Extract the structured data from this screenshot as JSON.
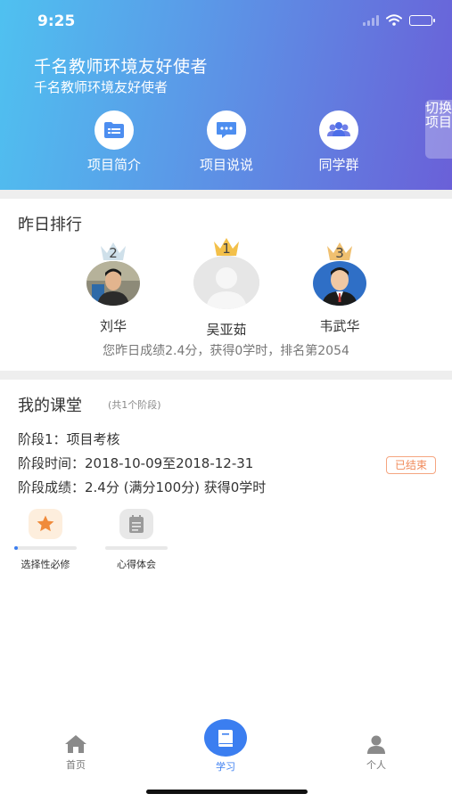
{
  "status_bar": {
    "time": "9:25"
  },
  "header": {
    "title": "千名教师环境友好使者",
    "subtitle": "千名教师环境友好使者",
    "switch_label": "切换项目",
    "actions": [
      {
        "label": "项目简介",
        "icon": "intro-icon"
      },
      {
        "label": "项目说说",
        "icon": "chat-icon"
      },
      {
        "label": "同学群",
        "icon": "group-icon"
      }
    ]
  },
  "ranking": {
    "title": "昨日排行",
    "entries": [
      {
        "rank": "2",
        "name": "刘华"
      },
      {
        "rank": "1",
        "name": "吴亚茹"
      },
      {
        "rank": "3",
        "name": "韦武华"
      }
    ],
    "summary": "您昨日成绩2.4分，获得0学时，排名第2054"
  },
  "course": {
    "title": "我的课堂",
    "count": "(共1个阶段)",
    "stage": "阶段1：项目考核",
    "time": "阶段时间：2018-10-09至2018-12-31",
    "score": "阶段成绩：2.4分 (满分100分) 获得0学时",
    "status": "已结束",
    "modules": [
      {
        "label": "选择性必修",
        "icon": "star-icon",
        "progress": 0.05
      },
      {
        "label": "心得体会",
        "icon": "notes-icon",
        "progress": 0
      }
    ]
  },
  "tabbar": {
    "items": [
      {
        "label": "首页",
        "icon": "home-icon"
      },
      {
        "label": "学习",
        "icon": "book-icon"
      },
      {
        "label": "个人",
        "icon": "person-icon"
      }
    ]
  },
  "colors": {
    "accent": "#3b7ef0",
    "badge": "#f08a5a",
    "gold": "#f3c04a",
    "silver": "#cfe0ea",
    "bronze": "#f0c070"
  }
}
